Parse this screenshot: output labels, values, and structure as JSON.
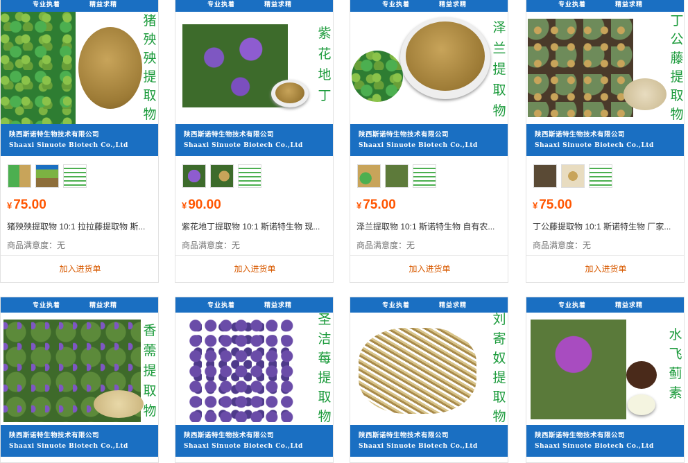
{
  "products": [
    {
      "banner_left": "专业执着",
      "banner_right": "精益求精",
      "title_vertical": "猪殃殃提取物",
      "company_cn": "陕西斯诺特生物技术有限公司",
      "company_en": "Shaaxi Sinuote Biotech Co.,Ltd",
      "currency": "¥",
      "price": "75.00",
      "name": "猪殃殃提取物 10:1 拉拉藤提取物 斯...",
      "satisfaction": "商品满意度：无",
      "cart": "加入进货单"
    },
    {
      "banner_left": "专业执着",
      "banner_right": "精益求精",
      "title_vertical": "紫花地丁",
      "company_cn": "陕西斯诺特生物技术有限公司",
      "company_en": "Shaaxi Sinuote Biotech Co.,Ltd",
      "currency": "¥",
      "price": "90.00",
      "name": "紫花地丁提取物 10:1 斯诺特生物 现...",
      "satisfaction": "商品满意度：无",
      "cart": "加入进货单"
    },
    {
      "banner_left": "专业执着",
      "banner_right": "精益求精",
      "title_vertical": "泽兰提取物",
      "company_cn": "陕西斯诺特生物技术有限公司",
      "company_en": "Shaaxi Sinuote Biotech Co.,Ltd",
      "currency": "¥",
      "price": "75.00",
      "name": "泽兰提取物 10:1 斯诺特生物 自有农...",
      "satisfaction": "商品满意度：无",
      "cart": "加入进货单"
    },
    {
      "banner_left": "专业执着",
      "banner_right": "精益求精",
      "title_vertical": "丁公藤提取物",
      "company_cn": "陕西斯诺特生物技术有限公司",
      "company_en": "Shaaxi Sinuote Biotech Co.,Ltd",
      "currency": "¥",
      "price": "75.00",
      "name": "丁公藤提取物 10:1 斯诺特生物 厂家...",
      "satisfaction": "商品满意度：无",
      "cart": "加入进货单"
    },
    {
      "banner_left": "专业执着",
      "banner_right": "精益求精",
      "title_vertical": "香薷提取物",
      "company_cn": "陕西斯诺特生物技术有限公司",
      "company_en": "Shaaxi Sinuote Biotech Co.,Ltd"
    },
    {
      "banner_left": "专业执着",
      "banner_right": "精益求精",
      "title_vertical": "圣洁莓提取物",
      "company_cn": "陕西斯诺特生物技术有限公司",
      "company_en": "Shaaxi Sinuote Biotech Co.,Ltd"
    },
    {
      "banner_left": "专业执着",
      "banner_right": "精益求精",
      "title_vertical": "刘寄奴提取物",
      "company_cn": "陕西斯诺特生物技术有限公司",
      "company_en": "Shaaxi Sinuote Biotech Co.,Ltd"
    },
    {
      "banner_left": "专业执着",
      "banner_right": "精益求精",
      "title_vertical": "水飞蓟素",
      "company_cn": "陕西斯诺特生物技术有限公司",
      "company_en": "Shaaxi Sinuote Biotech Co.,Ltd"
    }
  ],
  "colors": {
    "banner_blue": "#1a6fc2",
    "title_green": "#1a9a3a",
    "price_orange": "#ff5500",
    "cart_orange": "#d85a00"
  }
}
